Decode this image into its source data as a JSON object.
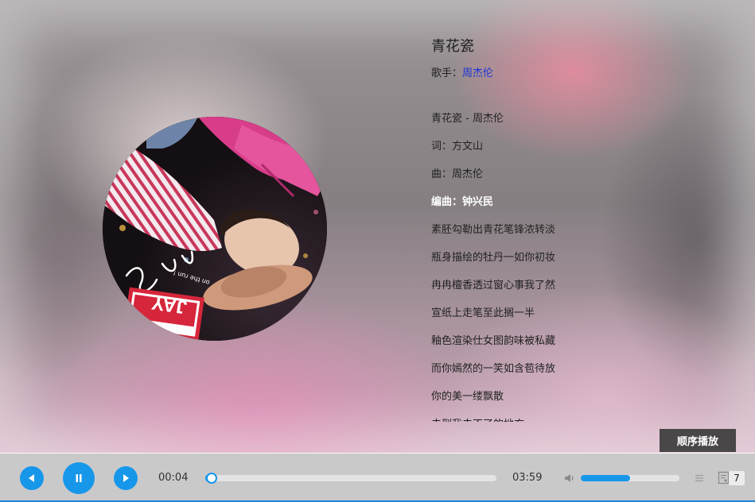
{
  "song": {
    "title": "青花瓷",
    "singer_label": "歌手：",
    "singer_name": "周杰伦"
  },
  "lyrics": [
    "青花瓷 - 周杰伦",
    "词：方文山",
    "曲：周杰伦",
    "编曲：钟兴民",
    "素胚勾勒出青花笔锋浓转淡",
    "瓶身描绘的牡丹一如你初妆",
    "冉冉檀香透过窗心事我了然",
    "宣纸上走笔至此搁一半",
    "釉色渲染仕女图韵味被私藏",
    "而你嫣然的一笑如含苞待放",
    "你的美一缕飘散",
    "去到我去不了的地方"
  ],
  "active_lyric_index": 3,
  "album_art": {
    "cover_text": "JAY",
    "tagline": "on the run !"
  },
  "play_mode": "顺序播放",
  "controls": {
    "prev_icon": "prev-triangle-icon",
    "pause_icon": "pause-icon",
    "next_icon": "next-triangle-icon",
    "current_time": "00:04",
    "total_time": "03:59",
    "progress_fraction": 0.017,
    "volume_fraction": 0.5,
    "playlist_count": "7"
  },
  "colors": {
    "accent": "#1797ea",
    "singer_link": "#1c35d8",
    "mode_button_bg": "#4a4748",
    "bottom_line": "#1d86d8"
  }
}
